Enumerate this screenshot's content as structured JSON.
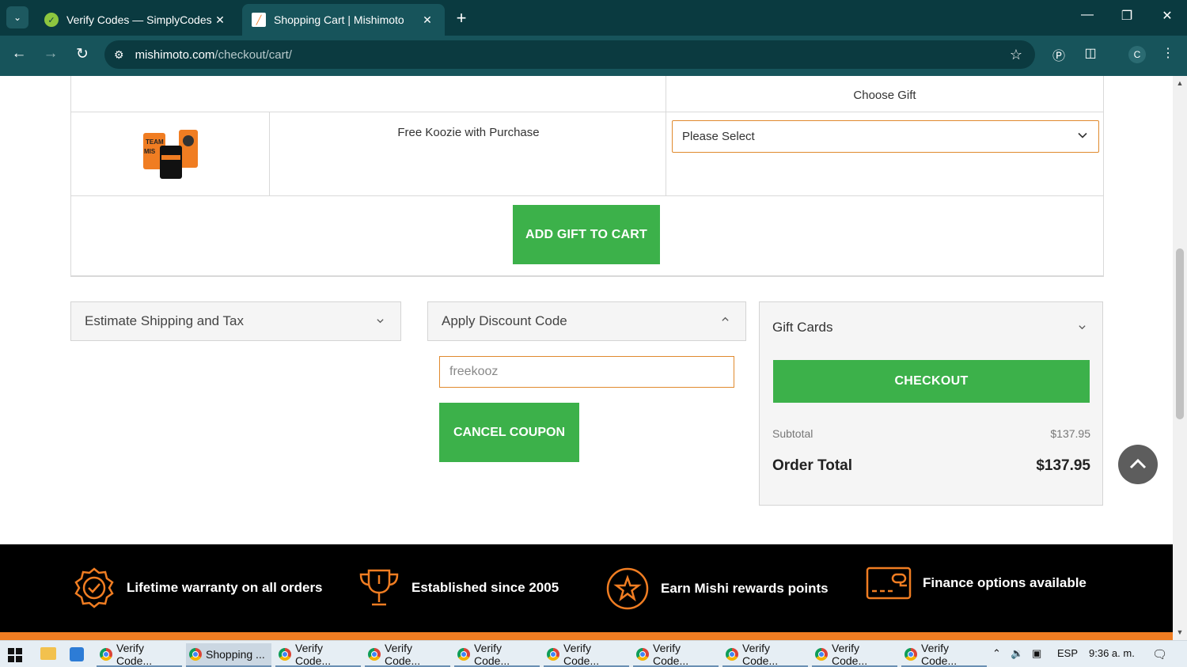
{
  "browser": {
    "tabs": [
      {
        "title": "Verify Codes — SimplyCodes",
        "active": false
      },
      {
        "title": "Shopping Cart | Mishimoto",
        "active": true
      }
    ],
    "url_host": "mishimoto.com",
    "url_path": "/checkout/cart/",
    "profile_initial": "C"
  },
  "gift": {
    "choose_label": "Choose Gift",
    "product_name": "Free Koozie with Purchase",
    "select_value": "Please Select",
    "add_button": "ADD GIFT TO CART"
  },
  "shipping": {
    "label": "Estimate Shipping and Tax"
  },
  "discount": {
    "label": "Apply Discount Code",
    "code_value": "freekooz",
    "cancel_button": "CANCEL COUPON"
  },
  "summary": {
    "gift_cards_label": "Gift Cards",
    "checkout_button": "CHECKOUT",
    "subtotal_label": "Subtotal",
    "subtotal_value": "$137.95",
    "total_label": "Order Total",
    "total_value": "$137.95"
  },
  "footer": {
    "features": [
      {
        "icon": "warranty-badge-icon",
        "label": "Lifetime warranty on all orders"
      },
      {
        "icon": "trophy-icon",
        "label": "Established since 2005"
      },
      {
        "icon": "star-circle-icon",
        "label": "Earn Mishi rewards points"
      },
      {
        "icon": "card-icon",
        "label": "Finance options available"
      }
    ]
  },
  "taskbar": {
    "apps": [
      "Verify Code...",
      "Shopping ...",
      "Verify Code...",
      "Verify Code...",
      "Verify Code...",
      "Verify Code...",
      "Verify Code...",
      "Verify Code...",
      "Verify Code...",
      "Verify Code..."
    ],
    "language": "ESP",
    "time": "9:36 a. m."
  },
  "colors": {
    "accent_green": "#3cb14a",
    "accent_orange": "#f07d22",
    "browser_dark": "#0a3a40"
  }
}
